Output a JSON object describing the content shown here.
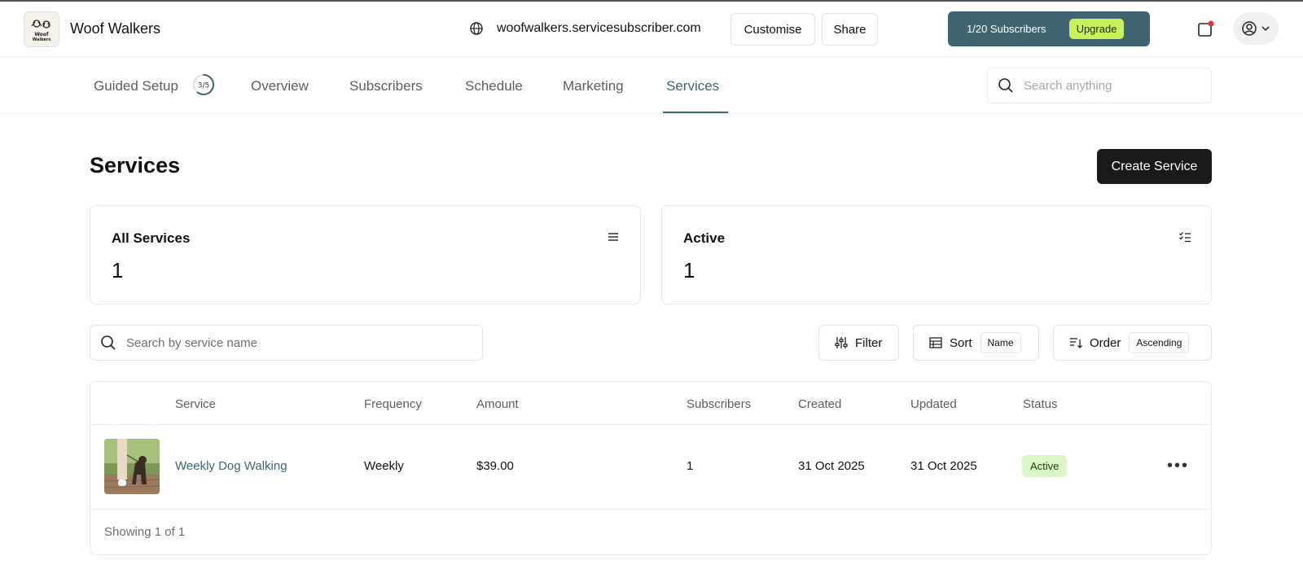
{
  "header": {
    "brand": "Woof Walkers",
    "logo_text": "Woof Walkers",
    "domain": "woofwalkers.servicesubscriber.com",
    "customise_label": "Customise",
    "share_label": "Share",
    "subscribers_label": "1/20 Subscribers",
    "upgrade_label": "Upgrade"
  },
  "nav": {
    "tabs": [
      {
        "label": "Guided Setup",
        "badge": "3/5"
      },
      {
        "label": "Overview"
      },
      {
        "label": "Subscribers"
      },
      {
        "label": "Schedule"
      },
      {
        "label": "Marketing"
      },
      {
        "label": "Services",
        "active": true
      }
    ],
    "search_placeholder": "Search anything",
    "guided_setup_progress": 0.6
  },
  "page": {
    "title": "Services",
    "create_label": "Create Service"
  },
  "stats": [
    {
      "title": "All Services",
      "value": "1",
      "icon": "list-icon"
    },
    {
      "title": "Active",
      "value": "1",
      "icon": "checklist-icon"
    }
  ],
  "toolbar": {
    "search_placeholder": "Search by service name",
    "filter_label": "Filter",
    "sort_label": "Sort",
    "sort_value": "Name",
    "order_label": "Order",
    "order_value": "Ascending"
  },
  "table": {
    "columns": [
      "Service",
      "Frequency",
      "Amount",
      "Subscribers",
      "Created",
      "Updated",
      "Status"
    ],
    "rows": [
      {
        "service": "Weekly Dog Walking",
        "frequency": "Weekly",
        "amount": "$39.00",
        "subscribers": "1",
        "created": "31 Oct 2025",
        "updated": "31 Oct 2025",
        "status": "Active"
      }
    ],
    "footer": "Showing 1 of 1"
  },
  "colors": {
    "accent": "#3f6670",
    "upgrade": "#c9f25a",
    "status_active_bg": "#dcf7c6",
    "primary_button": "#1a1a1a"
  }
}
